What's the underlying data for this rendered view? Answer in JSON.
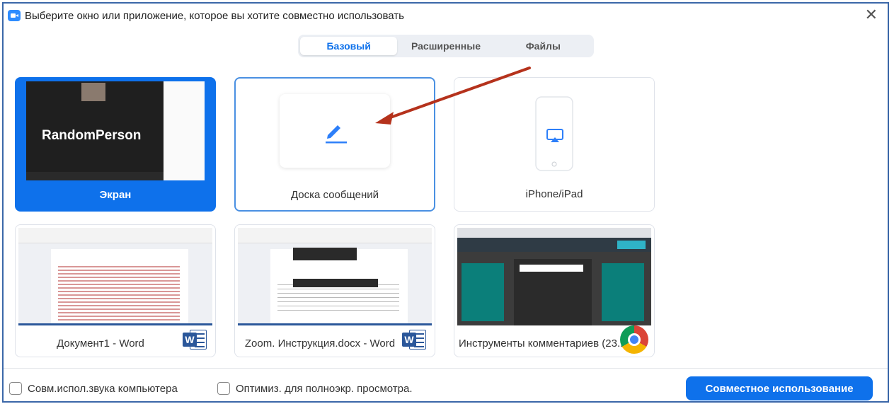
{
  "window": {
    "title": "Выберите окно или приложение, которое вы хотите совместно использовать",
    "close_glyph": "✕"
  },
  "tabs": [
    {
      "label": "Базовый",
      "active": true
    },
    {
      "label": "Расширенные",
      "active": false
    },
    {
      "label": "Файлы",
      "active": false
    }
  ],
  "options": {
    "screen": {
      "label": "Экран",
      "thumb_name": "RandomPerson"
    },
    "whiteboard": {
      "label": "Доска сообщений",
      "icon": "pencil-icon"
    },
    "iphone": {
      "label": "iPhone/iPad",
      "icon": "airplay-icon"
    }
  },
  "windows": [
    {
      "label": "Документ1 - Word",
      "app_icon": "word-icon"
    },
    {
      "label": "Zoom. Инструкция.docx - Word",
      "app_icon": "word-icon"
    },
    {
      "label": "Инструменты комментариев (23...",
      "app_icon": "chrome-icon"
    }
  ],
  "footer": {
    "share_sound": {
      "label": "Совм.испол.звука компьютера",
      "checked": false
    },
    "optimize": {
      "label": "Оптимиз. для полноэкр. просмотра.",
      "checked": false
    },
    "share_button": "Совместное использование"
  },
  "colors": {
    "accent": "#0e71eb",
    "arrow": "#b5321c"
  }
}
